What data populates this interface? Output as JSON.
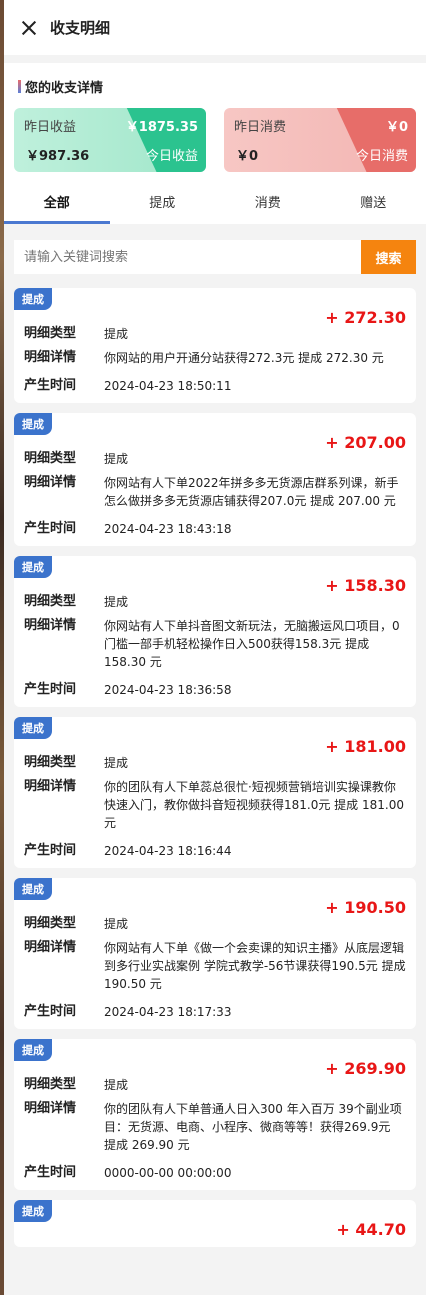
{
  "header": {
    "title": "收支明细"
  },
  "summary": {
    "title": "您的收支详情",
    "income": {
      "yesterday_label": "昨日收益",
      "yesterday_value": "￥1875.35",
      "today_label": "今日收益",
      "today_value": "￥987.36"
    },
    "expense": {
      "yesterday_label": "昨日消费",
      "yesterday_value": "￥0",
      "today_label": "今日消费",
      "today_value": "￥0"
    }
  },
  "tabs": [
    {
      "label": "全部"
    },
    {
      "label": "提成"
    },
    {
      "label": "消费"
    },
    {
      "label": "赠送"
    }
  ],
  "search": {
    "placeholder": "请输入关键词搜索",
    "button": "搜索"
  },
  "labels": {
    "type": "明细类型",
    "detail": "明细详情",
    "time": "产生时间"
  },
  "entries": [
    {
      "badge": "提成",
      "amount": "+ 272.30",
      "type": "提成",
      "detail": "你网站的用户开通分站获得272.3元 提成 272.30 元",
      "time": "2024-04-23 18:50:11"
    },
    {
      "badge": "提成",
      "amount": "+ 207.00",
      "type": "提成",
      "detail": "你网站有人下单2022年拼多多无货源店群系列课，新手怎么做拼多多无货源店铺获得207.0元 提成 207.00 元",
      "time": "2024-04-23 18:43:18"
    },
    {
      "badge": "提成",
      "amount": "+ 158.30",
      "type": "提成",
      "detail": "你网站有人下单抖音图文新玩法，无脑搬运风口项目，0门槛一部手机轻松操作日入500获得158.3元 提成 158.30 元",
      "time": "2024-04-23 18:36:58"
    },
    {
      "badge": "提成",
      "amount": "+ 181.00",
      "type": "提成",
      "detail": "你的团队有人下单蕊总很忙·短视频营销培训实操课教你快速入门，教你做抖音短视频获得181.0元 提成 181.00 元",
      "time": "2024-04-23 18:16:44"
    },
    {
      "badge": "提成",
      "amount": "+ 190.50",
      "type": "提成",
      "detail": "你网站有人下单《做一个会卖课的知识主播》从底层逻辑到多行业实战案例 学院式教学-56节课获得190.5元 提成 190.50 元",
      "time": "2024-04-23 18:17:33"
    },
    {
      "badge": "提成",
      "amount": "+ 269.90",
      "type": "提成",
      "detail": "你的团队有人下单普通人日入300 年入百万 39个副业项目：无货源、电商、小程序、微商等等！获得269.9元 提成 269.90 元",
      "time": "0000-00-00 00:00:00"
    },
    {
      "badge": "提成",
      "amount": "+ 44.70",
      "type": "",
      "detail": "",
      "time": ""
    }
  ],
  "colors": {
    "accent": "#4a78d0",
    "search_button": "#f5840f",
    "amount": "#e81616",
    "income": "#2bc38f",
    "expense": "#e76d69"
  }
}
